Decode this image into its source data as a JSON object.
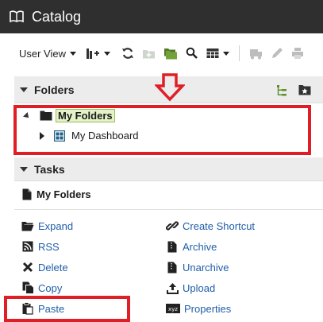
{
  "window": {
    "title": "Catalog"
  },
  "toolbar": {
    "view_label": "User View"
  },
  "folders": {
    "header": "Folders",
    "tree": [
      {
        "label": "My Folders",
        "selected": true
      },
      {
        "label": "My Dashboard"
      }
    ]
  },
  "tasks": {
    "header": "Tasks",
    "context": "My Folders",
    "left": [
      "Expand",
      "RSS",
      "Delete",
      "Copy",
      "Paste"
    ],
    "right": [
      "Create Shortcut",
      "Archive",
      "Unarchive",
      "Upload",
      "Properties"
    ]
  },
  "colors": {
    "highlight": "#e01e26",
    "link": "#1f5ea8",
    "titlebar": "#2f2f2f",
    "selection": "#e5f2c8"
  }
}
